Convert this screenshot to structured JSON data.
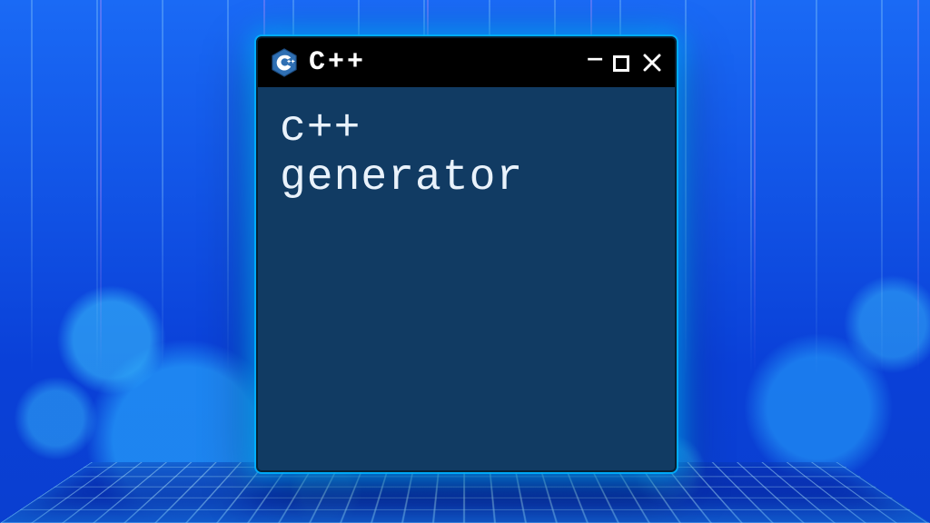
{
  "window": {
    "title": "C++",
    "icon": "cpp-logo-icon",
    "controls": {
      "minimize_label": "—",
      "maximize_label": "□",
      "close_label": "×"
    }
  },
  "content": {
    "line1": "c++",
    "line2": "generator"
  },
  "colors": {
    "window_bg": "#113b63",
    "titlebar_bg": "#000000",
    "glow": "#00aaff",
    "text": "#e9f2fb"
  }
}
